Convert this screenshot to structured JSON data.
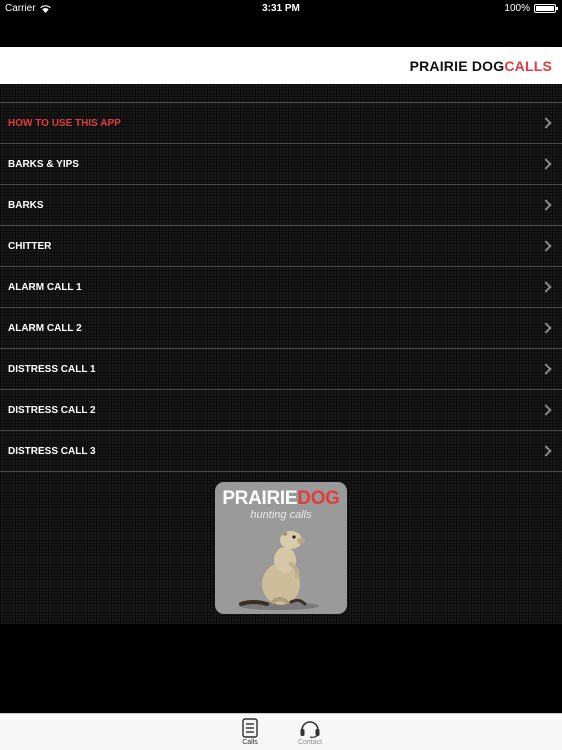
{
  "status_bar": {
    "carrier": "Carrier",
    "time": "3:31 PM",
    "battery": "100%",
    "battery_level": 1.0
  },
  "title": {
    "part1": "PRAIRIE DOG",
    "part2": "CALLS"
  },
  "menu": [
    {
      "label": "HOW TO USE THIS APP"
    },
    {
      "label": "BARKS & YIPS"
    },
    {
      "label": "BARKS"
    },
    {
      "label": "CHITTER"
    },
    {
      "label": "ALARM CALL 1"
    },
    {
      "label": "ALARM CALL 2"
    },
    {
      "label": "DISTRESS CALL 1"
    },
    {
      "label": "DISTRESS CALL 2"
    },
    {
      "label": "DISTRESS CALL 3"
    }
  ],
  "logo": {
    "line1a": "PRAIRIE",
    "line1b": "DOG",
    "line2": "hunting calls"
  },
  "tabs": [
    {
      "label": "Calls",
      "icon": "list-icon"
    },
    {
      "label": "Contact",
      "icon": "headset-icon"
    }
  ],
  "colors": {
    "accent": "#e23b3b",
    "background": "#000000",
    "row_divider": "#4a4a4a"
  }
}
